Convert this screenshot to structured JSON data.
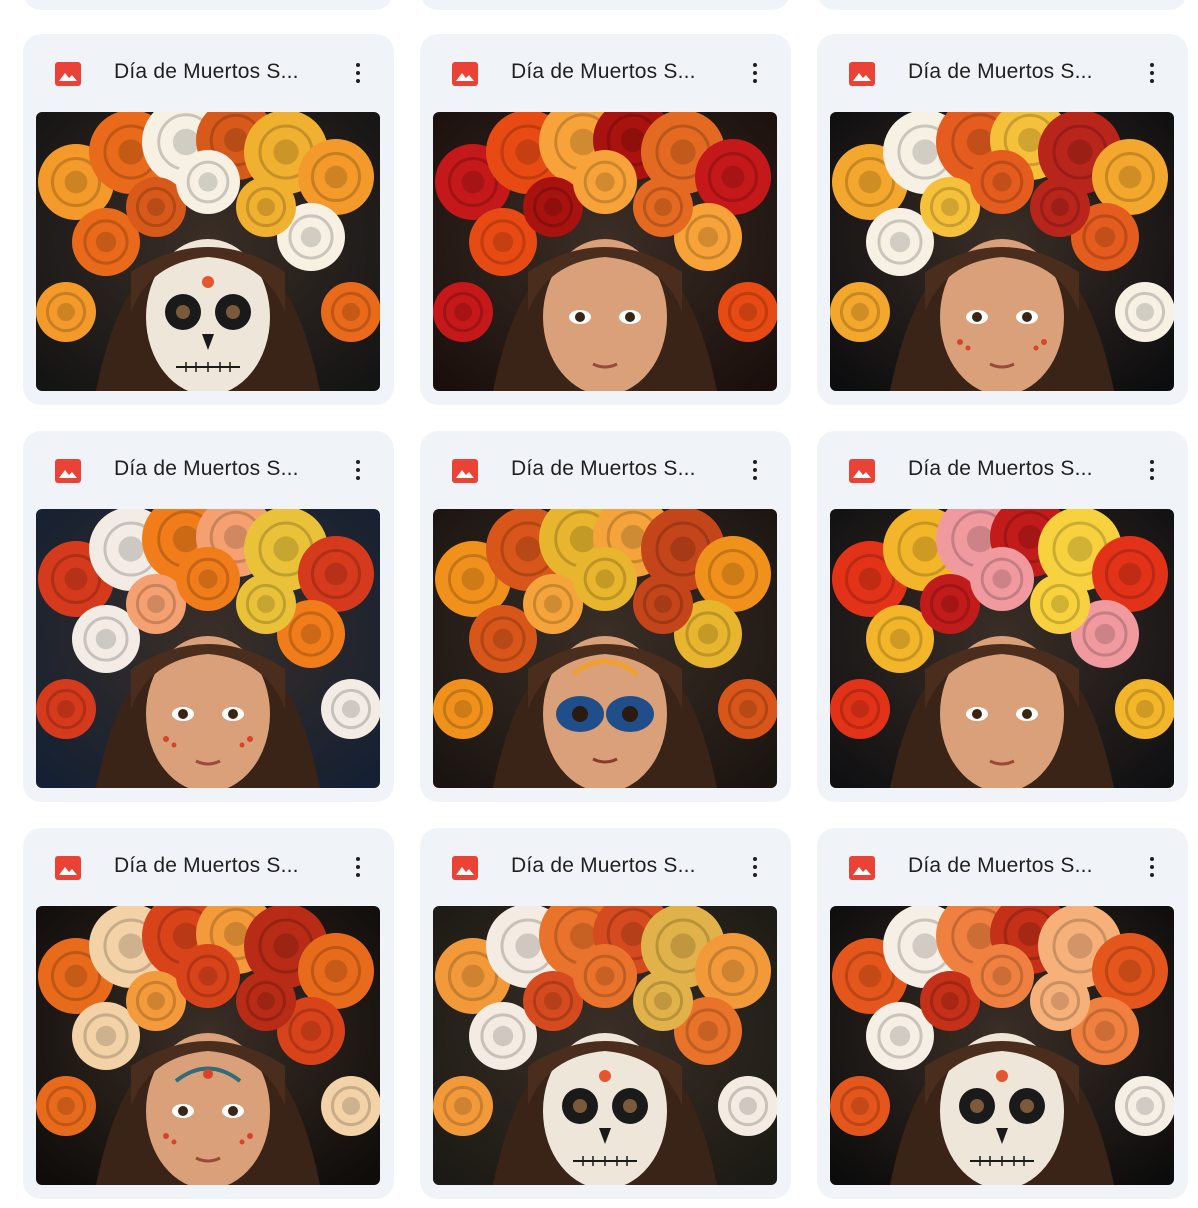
{
  "files": [
    {
      "title": "Día de Muertos S...",
      "variant": "sugar-skull",
      "bg": "#141414",
      "flowers": [
        "#f39a2a",
        "#e86a1a",
        "#f7f1e4",
        "#d85a1a",
        "#f0b030"
      ]
    },
    {
      "title": "Día de Muertos S...",
      "variant": "plain",
      "bg": "#1a0f0c",
      "flowers": [
        "#c4181a",
        "#e84a14",
        "#f7a33a",
        "#a8120f",
        "#e46a22"
      ]
    },
    {
      "title": "Día de Muertos S...",
      "variant": "freckles",
      "bg": "#0d0d0f",
      "flowers": [
        "#f3a72c",
        "#f7f1e4",
        "#e45c1e",
        "#f6c13a",
        "#b8251b"
      ]
    },
    {
      "title": "Día de Muertos S...",
      "variant": "freckles",
      "bg": "#142033",
      "flowers": [
        "#d63a1c",
        "#f2ece4",
        "#f07c1a",
        "#f4a070",
        "#e9c23a"
      ]
    },
    {
      "title": "Día de Muertos S...",
      "variant": "blue-mask",
      "bg": "#1a1410",
      "flowers": [
        "#f0911c",
        "#d8561a",
        "#e7b52e",
        "#f4a43a",
        "#c4451a"
      ]
    },
    {
      "title": "Día de Muertos S...",
      "variant": "plain",
      "bg": "#101012",
      "flowers": [
        "#e23318",
        "#f3b62a",
        "#f09aa0",
        "#c11b1b",
        "#f7d23e"
      ]
    },
    {
      "title": "Día de Muertos S...",
      "variant": "face-paint",
      "bg": "#0f0c0a",
      "flowers": [
        "#e86b1c",
        "#f2d2a6",
        "#d8431a",
        "#f39a3a",
        "#b82b16"
      ]
    },
    {
      "title": "Día de Muertos S...",
      "variant": "sugar-skull",
      "bg": "#1b1a14",
      "flowers": [
        "#f29a3a",
        "#f4ece2",
        "#e9732a",
        "#d54a1e",
        "#e2b24a"
      ]
    },
    {
      "title": "Día de Muertos S...",
      "variant": "sugar-skull",
      "bg": "#0c0c0c",
      "flowers": [
        "#e5561c",
        "#f6efe6",
        "#f08040",
        "#c43018",
        "#f6b07a"
      ]
    }
  ]
}
